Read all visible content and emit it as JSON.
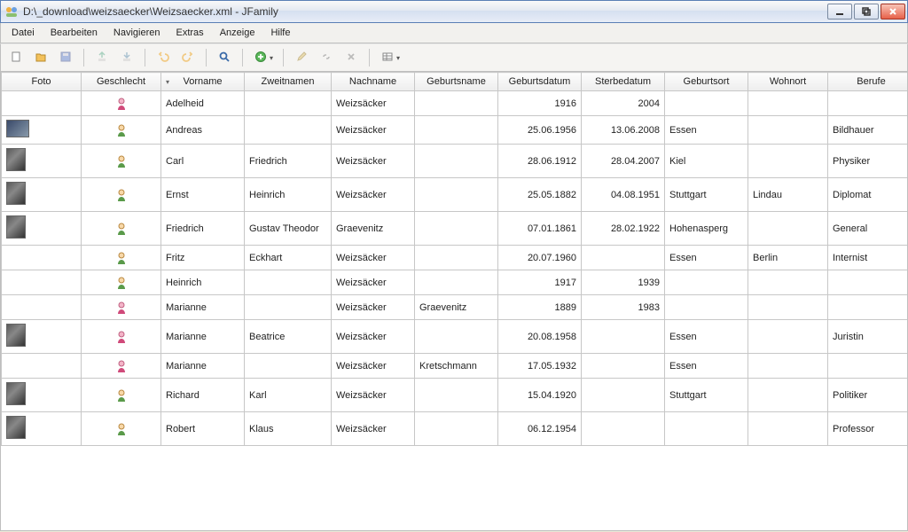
{
  "window": {
    "title": "D:\\_download\\weizsaecker\\Weizsaecker.xml - JFamily"
  },
  "menu": {
    "items": [
      "Datei",
      "Bearbeiten",
      "Navigieren",
      "Extras",
      "Anzeige",
      "Hilfe"
    ]
  },
  "toolbar": {
    "buttons": [
      {
        "name": "new-file",
        "icon": "doc",
        "enabled": true
      },
      {
        "name": "open-file",
        "icon": "folder",
        "enabled": true
      },
      {
        "name": "save-file",
        "icon": "disk",
        "enabled": false
      },
      {
        "sep": true
      },
      {
        "name": "export",
        "icon": "out",
        "enabled": false
      },
      {
        "name": "import",
        "icon": "in",
        "enabled": false
      },
      {
        "sep": true
      },
      {
        "name": "undo",
        "icon": "undo",
        "enabled": false
      },
      {
        "name": "redo",
        "icon": "redo",
        "enabled": false
      },
      {
        "sep": true
      },
      {
        "name": "search",
        "icon": "search",
        "enabled": true
      },
      {
        "sep": true
      },
      {
        "name": "add-person",
        "icon": "add",
        "enabled": true,
        "dropdown": true
      },
      {
        "sep": true
      },
      {
        "name": "edit-person",
        "icon": "pencil",
        "enabled": false
      },
      {
        "name": "link",
        "icon": "link",
        "enabled": false
      },
      {
        "name": "delete",
        "icon": "x",
        "enabled": false
      },
      {
        "sep": true
      },
      {
        "name": "view-mode",
        "icon": "grid",
        "enabled": true,
        "dropdown": true
      }
    ]
  },
  "table": {
    "columns": [
      {
        "key": "foto",
        "label": "Foto"
      },
      {
        "key": "geschlecht",
        "label": "Geschlecht"
      },
      {
        "key": "vorname",
        "label": "Vorname",
        "sorted": true
      },
      {
        "key": "zweitnamen",
        "label": "Zweitnamen"
      },
      {
        "key": "nachname",
        "label": "Nachname"
      },
      {
        "key": "geburtsname",
        "label": "Geburtsname"
      },
      {
        "key": "geburtsdatum",
        "label": "Geburtsdatum"
      },
      {
        "key": "sterbedatum",
        "label": "Sterbedatum"
      },
      {
        "key": "geburtsort",
        "label": "Geburtsort"
      },
      {
        "key": "wohnort",
        "label": "Wohnort"
      },
      {
        "key": "berufe",
        "label": "Berufe"
      }
    ],
    "rows": [
      {
        "foto": "",
        "geschlecht": "f",
        "vorname": "Adelheid",
        "zweitnamen": "",
        "nachname": "Weizsäcker",
        "geburtsname": "",
        "geburtsdatum": "1916",
        "sterbedatum": "2004",
        "geburtsort": "",
        "wohnort": "",
        "berufe": ""
      },
      {
        "foto": "wide",
        "geschlecht": "m",
        "vorname": "Andreas",
        "zweitnamen": "",
        "nachname": "Weizsäcker",
        "geburtsname": "",
        "geburtsdatum": "25.06.1956",
        "sterbedatum": "13.06.2008",
        "geburtsort": "Essen",
        "wohnort": "",
        "berufe": "Bildhauer"
      },
      {
        "foto": "tall",
        "geschlecht": "m",
        "vorname": "Carl",
        "zweitnamen": "Friedrich",
        "nachname": "Weizsäcker",
        "geburtsname": "",
        "geburtsdatum": "28.06.1912",
        "sterbedatum": "28.04.2007",
        "geburtsort": "Kiel",
        "wohnort": "",
        "berufe": "Physiker"
      },
      {
        "foto": "tall",
        "geschlecht": "m",
        "vorname": "Ernst",
        "zweitnamen": "Heinrich",
        "nachname": "Weizsäcker",
        "geburtsname": "",
        "geburtsdatum": "25.05.1882",
        "sterbedatum": "04.08.1951",
        "geburtsort": "Stuttgart",
        "wohnort": "Lindau",
        "berufe": "Diplomat"
      },
      {
        "foto": "tall",
        "geschlecht": "m",
        "vorname": "Friedrich",
        "zweitnamen": "Gustav Theodor",
        "nachname": "Graevenitz",
        "geburtsname": "",
        "geburtsdatum": "07.01.1861",
        "sterbedatum": "28.02.1922",
        "geburtsort": "Hohenasperg",
        "wohnort": "",
        "berufe": "General"
      },
      {
        "foto": "",
        "geschlecht": "m",
        "vorname": "Fritz",
        "zweitnamen": "Eckhart",
        "nachname": "Weizsäcker",
        "geburtsname": "",
        "geburtsdatum": "20.07.1960",
        "sterbedatum": "",
        "geburtsort": "Essen",
        "wohnort": "Berlin",
        "berufe": "Internist"
      },
      {
        "foto": "",
        "geschlecht": "m",
        "vorname": "Heinrich",
        "zweitnamen": "",
        "nachname": "Weizsäcker",
        "geburtsname": "",
        "geburtsdatum": "1917",
        "sterbedatum": "1939",
        "geburtsort": "",
        "wohnort": "",
        "berufe": ""
      },
      {
        "foto": "",
        "geschlecht": "f",
        "vorname": "Marianne",
        "zweitnamen": "",
        "nachname": "Weizsäcker",
        "geburtsname": "Graevenitz",
        "geburtsdatum": "1889",
        "sterbedatum": "1983",
        "geburtsort": "",
        "wohnort": "",
        "berufe": ""
      },
      {
        "foto": "tall",
        "geschlecht": "f",
        "vorname": "Marianne",
        "zweitnamen": "Beatrice",
        "nachname": "Weizsäcker",
        "geburtsname": "",
        "geburtsdatum": "20.08.1958",
        "sterbedatum": "",
        "geburtsort": "Essen",
        "wohnort": "",
        "berufe": "Juristin"
      },
      {
        "foto": "",
        "geschlecht": "f",
        "vorname": "Marianne",
        "zweitnamen": "",
        "nachname": "Weizsäcker",
        "geburtsname": "Kretschmann",
        "geburtsdatum": "17.05.1932",
        "sterbedatum": "",
        "geburtsort": "Essen",
        "wohnort": "",
        "berufe": ""
      },
      {
        "foto": "tall",
        "geschlecht": "m",
        "vorname": "Richard",
        "zweitnamen": "Karl",
        "nachname": "Weizsäcker",
        "geburtsname": "",
        "geburtsdatum": "15.04.1920",
        "sterbedatum": "",
        "geburtsort": "Stuttgart",
        "wohnort": "",
        "berufe": "Politiker"
      },
      {
        "foto": "tall",
        "geschlecht": "m",
        "vorname": "Robert",
        "zweitnamen": "Klaus",
        "nachname": "Weizsäcker",
        "geburtsname": "",
        "geburtsdatum": "06.12.1954",
        "sterbedatum": "",
        "geburtsort": "",
        "wohnort": "",
        "berufe": "Professor"
      }
    ]
  }
}
